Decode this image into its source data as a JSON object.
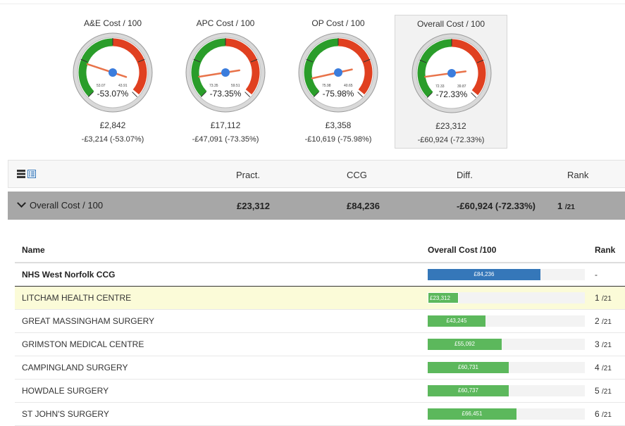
{
  "gauges": [
    {
      "title": "A&E Cost / 100",
      "value": -53.07,
      "value_label": "-53.07%",
      "low_tick": "53.07",
      "high_tick": "43.91",
      "amount": "£2,842",
      "diff": "-£3,214 (-53.07%)",
      "selected": false
    },
    {
      "title": "APC Cost / 100",
      "value": -73.35,
      "value_label": "-73.35%",
      "low_tick": "73.35",
      "high_tick": "59.51",
      "amount": "£17,112",
      "diff": "-£47,091 (-73.35%)",
      "selected": false
    },
    {
      "title": "OP Cost / 100",
      "value": -75.98,
      "value_label": "-75.98%",
      "low_tick": "75.98",
      "high_tick": "40.65",
      "amount": "£3,358",
      "diff": "-£10,619 (-75.98%)",
      "selected": false
    },
    {
      "title": "Overall Cost / 100",
      "value": -72.33,
      "value_label": "-72.33%",
      "low_tick": "72.33",
      "high_tick": "39.87",
      "amount": "£23,312",
      "diff": "-£60,924 (-72.33%)",
      "selected": true
    }
  ],
  "summary_header": {
    "pract": "Pract.",
    "ccg": "CCG",
    "diff": "Diff.",
    "rank": "Rank"
  },
  "summary_row": {
    "label": "Overall Cost / 100",
    "pract": "£23,312",
    "ccg": "£84,236",
    "diff": "-£60,924 (-72.33%)",
    "rank": "1",
    "rank_total": "/21"
  },
  "table": {
    "headers": {
      "name": "Name",
      "metric": "Overall Cost /100",
      "rank": "Rank"
    },
    "max": 84236,
    "ccg": {
      "name": "NHS West Norfolk CCG",
      "value": 84236,
      "value_label": "£84,236",
      "rank": "-"
    },
    "rows": [
      {
        "name": "LITCHAM HEALTH CENTRE",
        "value": 23312,
        "value_label": "£23,312",
        "rank": "1",
        "rank_total": "/21",
        "highlight": true
      },
      {
        "name": "GREAT MASSINGHAM SURGERY",
        "value": 43245,
        "value_label": "£43,245",
        "rank": "2",
        "rank_total": "/21",
        "highlight": false
      },
      {
        "name": "GRIMSTON MEDICAL CENTRE",
        "value": 55092,
        "value_label": "£55,092",
        "rank": "3",
        "rank_total": "/21",
        "highlight": false
      },
      {
        "name": "CAMPINGLAND SURGERY",
        "value": 60731,
        "value_label": "£60,731",
        "rank": "4",
        "rank_total": "/21",
        "highlight": false
      },
      {
        "name": "HOWDALE SURGERY",
        "value": 60737,
        "value_label": "£60,737",
        "rank": "5",
        "rank_total": "/21",
        "highlight": false
      },
      {
        "name": "ST JOHN'S SURGERY",
        "value": 66451,
        "value_label": "£66,451",
        "rank": "6",
        "rank_total": "/21",
        "highlight": false
      }
    ]
  },
  "colors": {
    "gauge_green": "#2a9d2a",
    "gauge_red": "#e04020",
    "needle": "#e8734a",
    "hub": "#3b7ddd",
    "ccg_bar": "#3577b9",
    "pract_bar": "#5cb85c",
    "highlight_row": "#fbfbd8"
  },
  "icons": {
    "table_view": "table-view-icon",
    "list_view": "list-view-icon",
    "expand": "chevron-down-icon"
  }
}
